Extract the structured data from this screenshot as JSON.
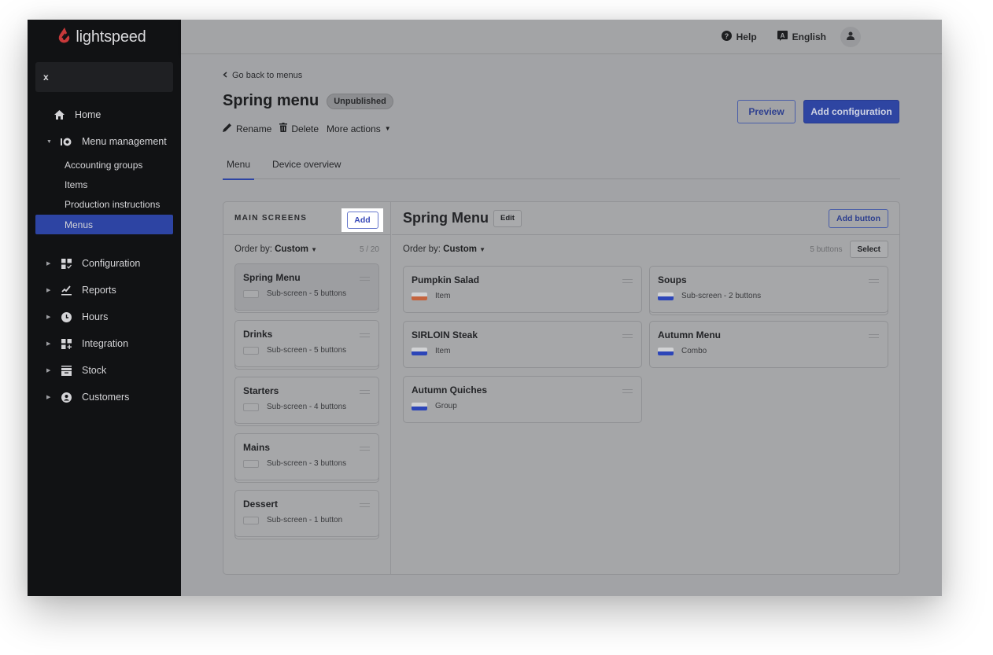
{
  "brand": {
    "name": "lightspeed",
    "logo_color": "#c8393a"
  },
  "sidebar": {
    "close_label": "x",
    "items": [
      {
        "label": "Home",
        "icon": "home-icon"
      },
      {
        "label": "Menu management",
        "icon": "menu-management-icon",
        "expanded": true,
        "children": [
          {
            "label": "Accounting groups"
          },
          {
            "label": "Items"
          },
          {
            "label": "Production instructions"
          },
          {
            "label": "Menus",
            "active": true
          }
        ]
      },
      {
        "label": "Configuration",
        "icon": "configuration-icon"
      },
      {
        "label": "Reports",
        "icon": "reports-icon"
      },
      {
        "label": "Hours",
        "icon": "clock-icon"
      },
      {
        "label": "Integration",
        "icon": "integration-icon"
      },
      {
        "label": "Stock",
        "icon": "stock-icon"
      },
      {
        "label": "Customers",
        "icon": "customers-icon"
      }
    ]
  },
  "topbar": {
    "help": "Help",
    "language": "English"
  },
  "page": {
    "back_link": "Go back to menus",
    "title": "Spring menu",
    "status": "Unpublished",
    "actions": {
      "rename": "Rename",
      "delete": "Delete",
      "more": "More actions"
    },
    "preview": "Preview",
    "add_configuration": "Add configuration",
    "tabs": [
      {
        "label": "Menu",
        "active": true
      },
      {
        "label": "Device overview"
      }
    ]
  },
  "main_screens": {
    "header": "MAIN SCREENS",
    "add": "Add",
    "order_label": "Order by:",
    "order_value": "Custom",
    "count": "5 / 20",
    "screens": [
      {
        "title": "Spring Menu",
        "sub": "Sub-screen - 5 buttons",
        "selected": true
      },
      {
        "title": "Drinks",
        "sub": "Sub-screen - 5 buttons"
      },
      {
        "title": "Starters",
        "sub": "Sub-screen - 4 buttons"
      },
      {
        "title": "Mains",
        "sub": "Sub-screen - 3 buttons"
      },
      {
        "title": "Dessert",
        "sub": "Sub-screen - 1 button"
      }
    ]
  },
  "screen_detail": {
    "title": "Spring Menu",
    "edit": "Edit",
    "add_button": "Add button",
    "order_label": "Order by:",
    "order_value": "Custom",
    "button_count": "5 buttons",
    "select": "Select",
    "buttons": [
      {
        "title": "Pumpkin Salad",
        "sub": "Item",
        "color": "#c4643e"
      },
      {
        "title": "Soups",
        "sub": "Sub-screen - 2 buttons",
        "color": "#2c45b8",
        "stacked": true
      },
      {
        "title": "SIRLOIN Steak",
        "sub": "Item",
        "color": "#2c45b8"
      },
      {
        "title": "Autumn Menu",
        "sub": "Combo",
        "color": "#2c45b8"
      },
      {
        "title": "Autumn Quiches",
        "sub": "Group",
        "color": "#2c45b8"
      }
    ]
  }
}
